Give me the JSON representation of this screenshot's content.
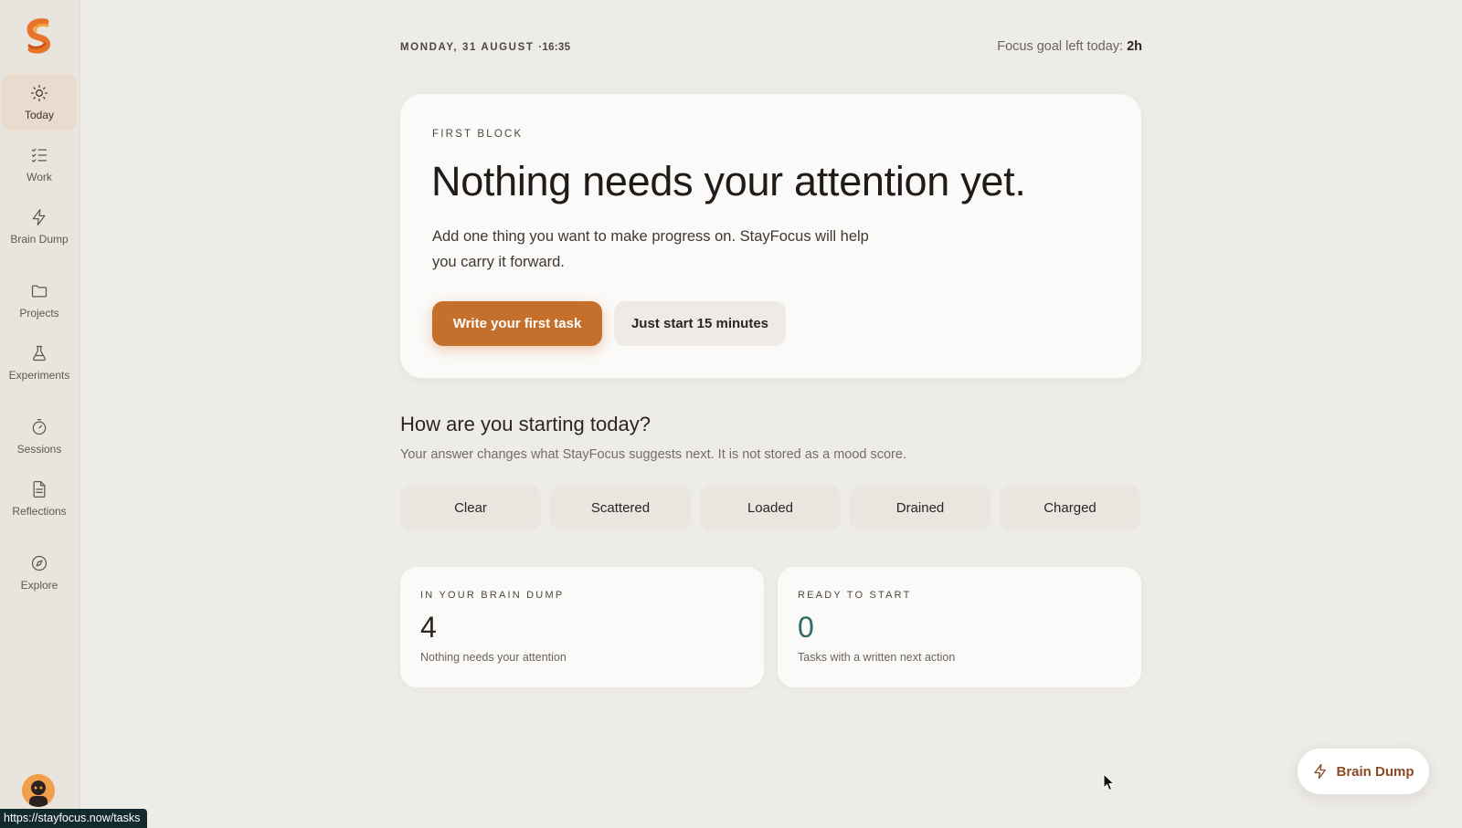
{
  "sidebar": {
    "items": [
      {
        "label": "Today",
        "icon": "sun-icon",
        "active": true
      },
      {
        "label": "Work",
        "icon": "checklist-icon"
      },
      {
        "label": "Brain Dump",
        "icon": "lightning-icon"
      },
      {
        "label": "Projects",
        "icon": "folder-icon"
      },
      {
        "label": "Experiments",
        "icon": "flask-icon"
      },
      {
        "label": "Sessions",
        "icon": "timer-icon"
      },
      {
        "label": "Reflections",
        "icon": "document-icon"
      },
      {
        "label": "Explore",
        "icon": "compass-icon"
      }
    ]
  },
  "status_url": "https://stayfocus.now/tasks",
  "header": {
    "date": "MONDAY, 31 AUGUST",
    "time": "·16:35",
    "focus_goal_label": "Focus goal left today:",
    "focus_goal_value": "2h"
  },
  "hero": {
    "eyebrow": "FIRST BLOCK",
    "title": "Nothing needs your attention yet.",
    "body": "Add one thing you want to make progress on. StayFocus will help you carry it forward.",
    "primary_button": "Write your first task",
    "secondary_button": "Just start 15 minutes"
  },
  "mood": {
    "title": "How are you starting today?",
    "subtitle": "Your answer changes what StayFocus suggests next. It is not stored as a mood score.",
    "options": [
      "Clear",
      "Scattered",
      "Loaded",
      "Drained",
      "Charged"
    ]
  },
  "stats": {
    "brain_dump": {
      "eyebrow": "IN YOUR BRAIN DUMP",
      "value": "4",
      "desc": "Nothing needs your attention"
    },
    "ready": {
      "eyebrow": "READY TO START",
      "value": "0",
      "desc": "Tasks with a written next action"
    }
  },
  "fab": {
    "label": "Brain Dump",
    "icon": "lightning-icon"
  },
  "colors": {
    "accent": "#c56f2c",
    "background": "#eeece7",
    "card": "#fbfaf8",
    "teal": "#2f6a66"
  }
}
